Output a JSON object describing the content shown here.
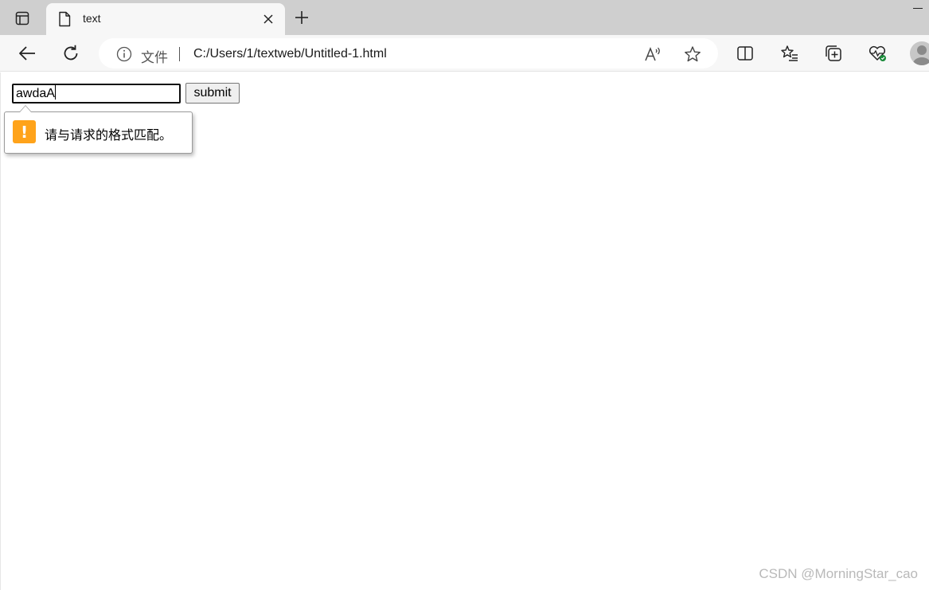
{
  "tab": {
    "title": "text"
  },
  "address_bar": {
    "scheme_label": "文件",
    "url": "C:/Users/1/textweb/Untitled-1.html"
  },
  "form": {
    "input_value": "awdaA",
    "submit_label": "submit"
  },
  "validation_tooltip": {
    "message": "请与请求的格式匹配。",
    "icon": "warning-icon",
    "icon_color": "#ffa31a"
  },
  "watermark": "CSDN @MorningStar_cao",
  "icons": {
    "tab_actions": "tab-actions-icon",
    "favicon": "page-icon",
    "close": "close-icon",
    "new_tab": "plus-icon",
    "back": "back-arrow-icon",
    "refresh": "refresh-icon",
    "info": "info-icon",
    "read_aloud": "read-aloud-icon",
    "favorite": "star-icon",
    "split_screen": "split-screen-icon",
    "favorites": "favorites-list-icon",
    "collections": "collections-icon",
    "performance": "heartbeat-icon",
    "profile": "profile-icon"
  }
}
